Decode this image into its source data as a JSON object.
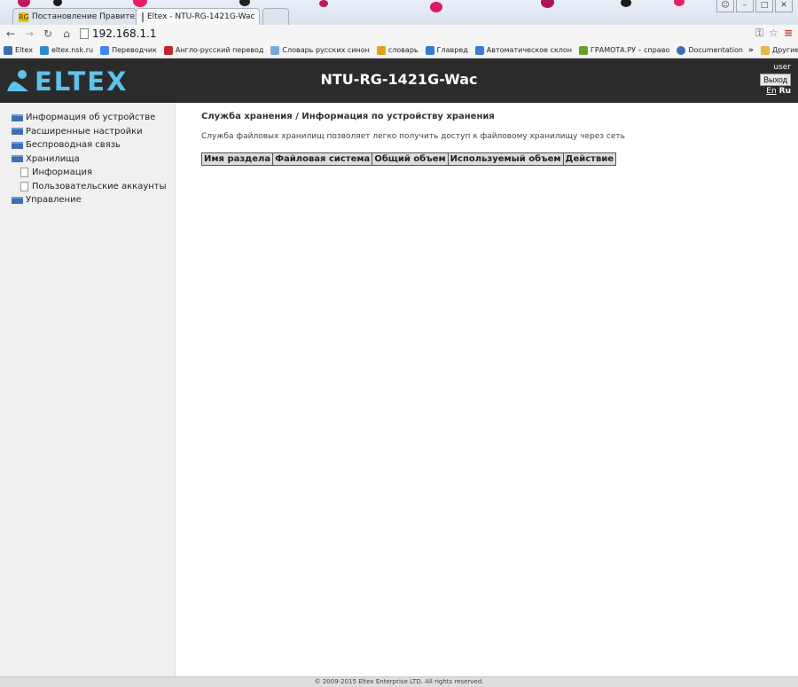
{
  "browser": {
    "tabs": [
      {
        "label": "Постановление Правитель"
      },
      {
        "label": "Eltex - NTU-RG-1421G-Wac"
      }
    ],
    "url": "192.168.1.1",
    "bookmarks": [
      {
        "label": "Eltex",
        "color": "#3a6fb3"
      },
      {
        "label": "eltex.nsk.ru",
        "color": "#2b8ad6"
      },
      {
        "label": "Переводчик",
        "color": "#4285f4"
      },
      {
        "label": "Англо-русский перевод",
        "color": "#c0272d"
      },
      {
        "label": "Словарь русских синон",
        "color": "#7aa7d8"
      },
      {
        "label": "словарь",
        "color": "#e0a020"
      },
      {
        "label": "Главред",
        "color": "#2f80d0"
      },
      {
        "label": "Автоматическое склон",
        "color": "#3a7fd0"
      },
      {
        "label": "ГРАМОТА.РУ – справо",
        "color": "#6aa02a"
      },
      {
        "label": "Documentation",
        "color": "#3a6fb3"
      }
    ],
    "other_bookmarks": "Другие закладки"
  },
  "header": {
    "logo": "ELTEX",
    "device": "NTU-RG-1421G-Wac",
    "user": "user",
    "logout": "Выход",
    "lang_en": "En",
    "lang_ru": "Ru"
  },
  "sidebar": {
    "items": [
      {
        "label": "Информация об устройстве"
      },
      {
        "label": "Расширенные настройки"
      },
      {
        "label": "Беспроводная связь"
      },
      {
        "label": "Хранилища"
      },
      {
        "label": "Информация"
      },
      {
        "label": "Пользовательские аккаунты"
      },
      {
        "label": "Управление"
      }
    ]
  },
  "main": {
    "title": "Служба хранения / Информация по устройству хранения",
    "description": "Служба файловых хранилищ позволяет легко получить доступ к файловому хранилищу через сеть",
    "table": {
      "columns": [
        "Имя раздела",
        "Файловая система",
        "Общий объем",
        "Используемый объем",
        "Действие"
      ]
    }
  },
  "footer": {
    "copyright": "© 2009-2015 Eltex Enterprise LTD. All rights reserved."
  }
}
